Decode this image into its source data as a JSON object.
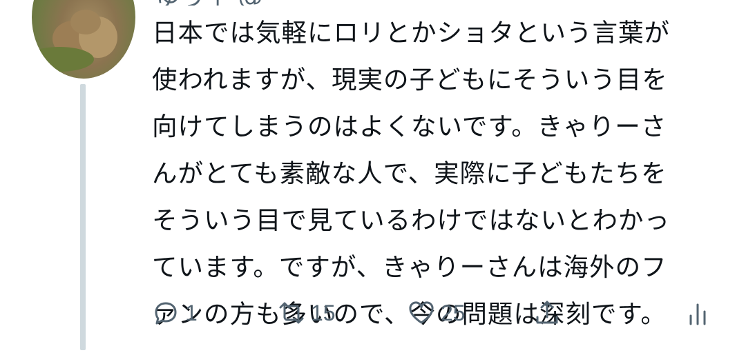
{
  "tweet": {
    "header_partial": "ゆう子 @ _",
    "text_lines": [
      "日本では気軽にロリとかショタという言葉が",
      "使われますが、現実の子どもにそういう目を",
      "向けてしまうのはよくないです。きゃりーさ",
      "んがとても素敵な人で、実際に子どもたちを",
      "そういう目で見ているわけではないとわかっ",
      "ています。ですが、きゃりーさんは海外のフ",
      "ァンの方も多いので、今の問題は深刻です。"
    ]
  },
  "actions": {
    "reply_count": "1",
    "retweet_count": "15",
    "like_count": "25"
  },
  "icons": [
    "reply-icon",
    "retweet-icon",
    "like-icon",
    "share-icon",
    "analytics-icon"
  ],
  "colors": {
    "text": "#0f1419",
    "muted": "#536471",
    "thread_line": "#cfd9de"
  }
}
